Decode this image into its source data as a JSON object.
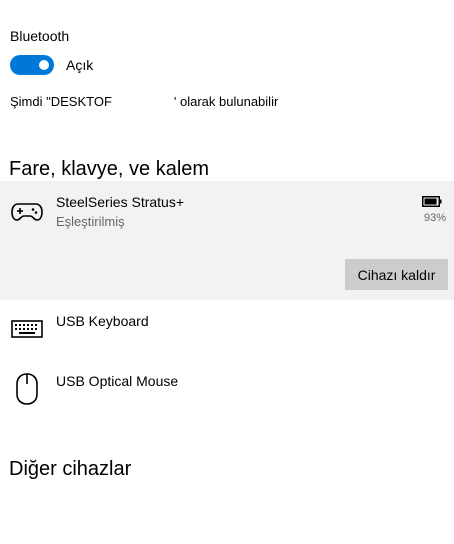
{
  "bluetooth": {
    "label": "Bluetooth",
    "toggle_state": "Açık",
    "toggle_on": true,
    "accent_color": "#0078d7",
    "discover_prefix": "Şimdi \"DESKTOF",
    "discover_suffix": "' olarak bulunabilir"
  },
  "sections": {
    "mouse_keyboard_pen": "Fare, klavye, ve kalem",
    "other_devices": "Diğer cihazlar"
  },
  "devices": [
    {
      "name": "SteelSeries Stratus+",
      "status": "Eşleştirilmiş",
      "icon": "gamepad-icon",
      "battery": "93%",
      "battery_level": 0.93,
      "selected": true,
      "remove_label": "Cihazı kaldır"
    },
    {
      "name": "USB Keyboard",
      "icon": "keyboard-icon"
    },
    {
      "name": "USB Optical Mouse",
      "icon": "mouse-icon"
    }
  ]
}
